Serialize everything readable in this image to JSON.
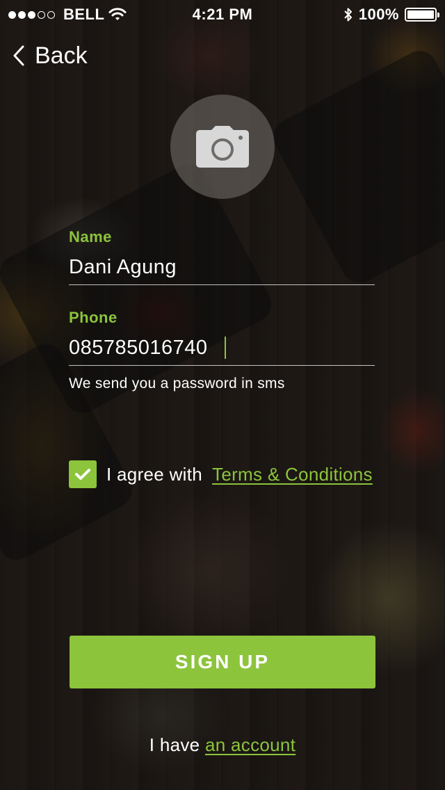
{
  "status_bar": {
    "signal_dots_filled": 3,
    "signal_dots_total": 5,
    "carrier": "BELL",
    "wifi_icon": "wifi-icon",
    "time": "4:21 PM",
    "bluetooth_icon": "bluetooth-icon",
    "battery_percent_text": "100%",
    "battery_level": 1.0
  },
  "nav": {
    "back_icon": "chevron-left-icon",
    "back_label": "Back"
  },
  "avatar": {
    "icon": "camera-icon"
  },
  "form": {
    "name": {
      "label": "Name",
      "value": "Dani Agung"
    },
    "phone": {
      "label": "Phone",
      "value": "085785016740"
    },
    "hint": "We send you a password in sms"
  },
  "terms": {
    "checked": true,
    "prefix": "I agree with",
    "link": "Terms & Conditions"
  },
  "signup_button": "SIGN UP",
  "footer": {
    "prefix": "I have",
    "link": "an account"
  },
  "colors": {
    "accent": "#8cc43c",
    "text": "#ffffff"
  }
}
